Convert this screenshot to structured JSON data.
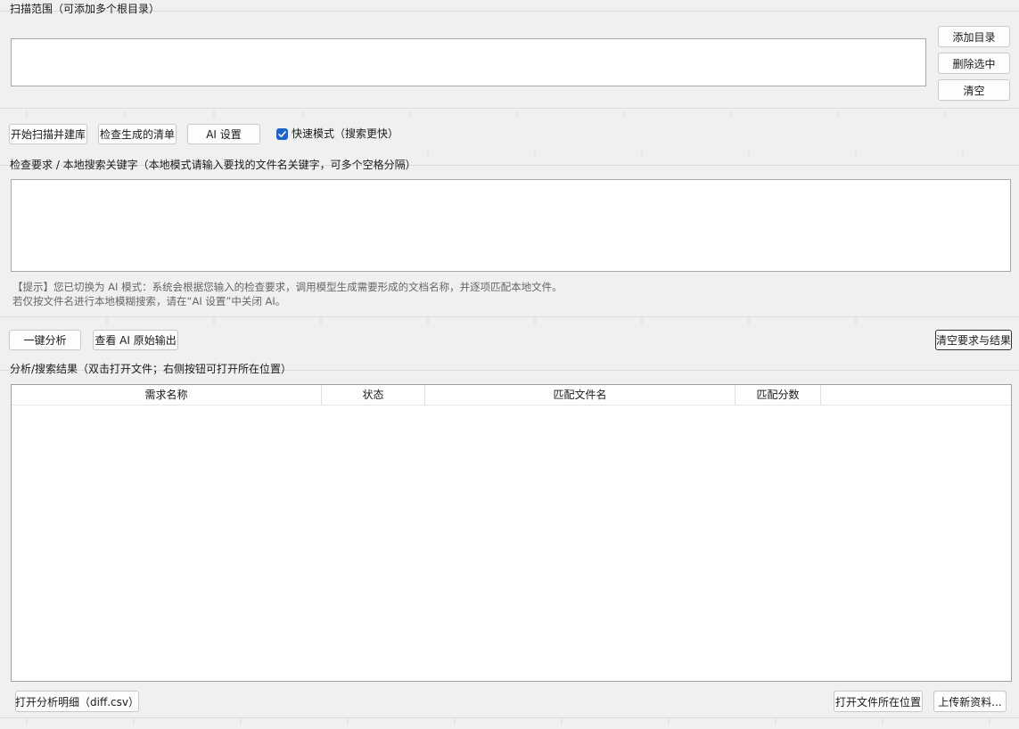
{
  "scan_group": {
    "label": "扫描范围（可添加多个根目录）",
    "add_dir": "添加目录",
    "remove_selected": "删除选中",
    "clear": "清空"
  },
  "toolbar": {
    "start_scan": "开始扫描并建库",
    "check_list": "检查生成的清单",
    "ai_settings": "AI 设置",
    "fast_mode_label": "快速模式（搜索更快）",
    "fast_mode_checked": true
  },
  "requirement_group": {
    "label": "检查要求 / 本地搜索关键字（本地模式请输入要找的文件名关键字，可多个空格分隔）",
    "hint_line1": "【提示】您已切换为 AI 模式：系统会根据您输入的检查要求，调用模型生成需要形成的文档名称，并逐项匹配本地文件。",
    "hint_line2": "若仅按文件名进行本地模糊搜索，请在“AI 设置”中关闭 AI。"
  },
  "actions": {
    "one_click": "一键分析",
    "view_ai_output": "查看 AI 原始输出",
    "clear_req_results": "清空要求与结果"
  },
  "results_group": {
    "label": "分析/搜索结果（双击打开文件；右侧按钮可打开所在位置）",
    "columns": [
      "需求名称",
      "状态",
      "匹配文件名",
      "匹配分数"
    ],
    "rows": []
  },
  "footer": {
    "open_diff": "打开分析明细（diff.csv）",
    "open_location": "打开文件所在位置",
    "upload_new": "上传新资料..."
  },
  "colors": {
    "background": "#f0f0f0",
    "checkbox_accent": "#1e64c8",
    "hint_text": "#666666"
  }
}
